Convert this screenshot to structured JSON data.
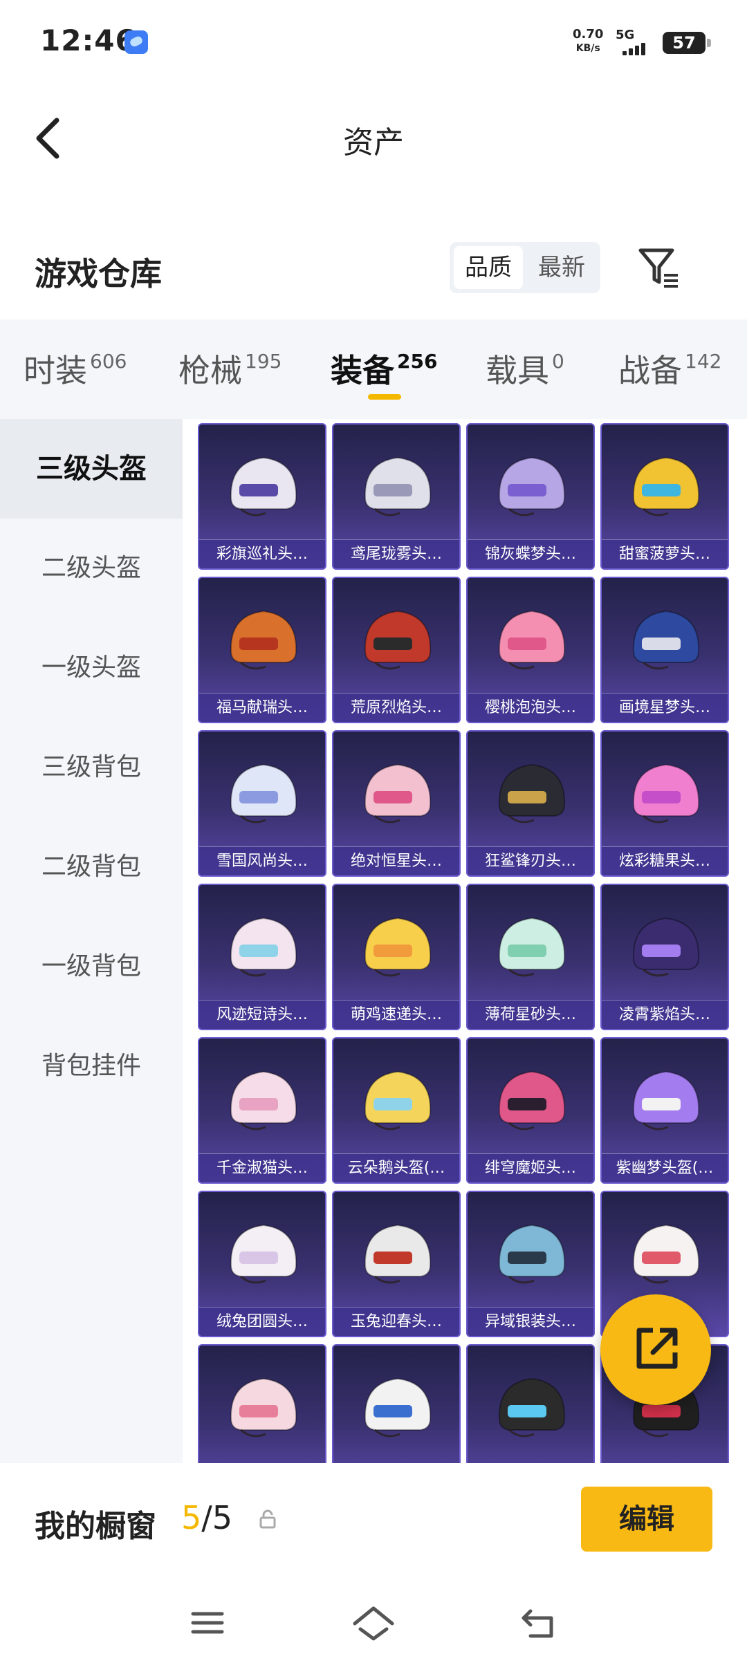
{
  "status_bar": {
    "time": "12:46",
    "speed_value": "0.70",
    "speed_unit": "KB/s",
    "network": "5G",
    "battery": "57"
  },
  "header": {
    "title": "资产"
  },
  "section": {
    "title": "游戏仓库",
    "sort_options": [
      "品质",
      "最新"
    ],
    "active_sort": "品质"
  },
  "categories": [
    {
      "label": "时装",
      "count": "606"
    },
    {
      "label": "枪械",
      "count": "195"
    },
    {
      "label": "装备",
      "count": "256"
    },
    {
      "label": "载具",
      "count": "0"
    },
    {
      "label": "战备",
      "count": "142"
    }
  ],
  "active_category": "装备",
  "subcategories": [
    "三级头盔",
    "二级头盔",
    "一级头盔",
    "三级背包",
    "二级背包",
    "一级背包",
    "背包挂件"
  ],
  "active_subcategory": "三级头盔",
  "items": [
    {
      "label": "彩旗巡礼头…",
      "color": "#e9e6f2",
      "accent": "#5a4aa8"
    },
    {
      "label": "鸢尾珑雾头…",
      "color": "#dfe0ea",
      "accent": "#9a9ab8"
    },
    {
      "label": "锦灰蝶梦头…",
      "color": "#b7a6e6",
      "accent": "#7a5fd0"
    },
    {
      "label": "甜蜜菠萝头…",
      "color": "#f1c232",
      "accent": "#3fb6e0"
    },
    {
      "label": "福马献瑞头…",
      "color": "#d9702c",
      "accent": "#b5351f"
    },
    {
      "label": "荒原烈焰头…",
      "color": "#c0392b",
      "accent": "#2b2b2b"
    },
    {
      "label": "樱桃泡泡头…",
      "color": "#f48fb1",
      "accent": "#e0578a"
    },
    {
      "label": "画境星梦头…",
      "color": "#2e4aa0",
      "accent": "#d9dbe8"
    },
    {
      "label": "雪国风尚头…",
      "color": "#dfe6f8",
      "accent": "#8c9be0"
    },
    {
      "label": "绝对恒星头…",
      "color": "#f3c0cf",
      "accent": "#e0578a"
    },
    {
      "label": "狂鲨锋刃头…",
      "color": "#2b2b33",
      "accent": "#c9a24a"
    },
    {
      "label": "炫彩糖果头…",
      "color": "#f07fd0",
      "accent": "#c44fc9"
    },
    {
      "label": "风迹短诗头…",
      "color": "#f3e4ef",
      "accent": "#8fd3e8"
    },
    {
      "label": "萌鸡速递头…",
      "color": "#f7cf4a",
      "accent": "#f29b3d"
    },
    {
      "label": "薄荷星砂头…",
      "color": "#cdeee2",
      "accent": "#7fcfb0"
    },
    {
      "label": "凌霄紫焰头…",
      "color": "#3a2c6e",
      "accent": "#a37df0"
    },
    {
      "label": "千金淑猫头…",
      "color": "#f6dbe8",
      "accent": "#e8a2c2"
    },
    {
      "label": "云朵鹅头盔(…",
      "color": "#f4d45a",
      "accent": "#8fd3e8"
    },
    {
      "label": "绯穹魔姬头…",
      "color": "#e0578a",
      "accent": "#2b1f2f"
    },
    {
      "label": "紫幽梦头盔(…",
      "color": "#a37df0",
      "accent": "#f2f2f2"
    },
    {
      "label": "绒兔团圆头…",
      "color": "#f4eff4",
      "accent": "#d9c6e6"
    },
    {
      "label": "玉兔迎春头…",
      "color": "#e9e9e9",
      "accent": "#c0392b"
    },
    {
      "label": "异域银装头…",
      "color": "#7fb7d6",
      "accent": "#2b3a4a"
    },
    {
      "label": "",
      "color": "#f6f2f2",
      "accent": "#e05a6a"
    },
    {
      "label": "",
      "color": "#f6d8e0",
      "accent": "#e87f9a"
    },
    {
      "label": "",
      "color": "#f2f2f2",
      "accent": "#3a6fd0"
    },
    {
      "label": "",
      "color": "#2b2b2b",
      "accent": "#5ac8f0"
    },
    {
      "label": "",
      "color": "#1f1f1f",
      "accent": "#d0304a"
    }
  ],
  "bottom_bar": {
    "title": "我的橱窗",
    "count_current": "5",
    "count_sep": "/",
    "count_total": "5",
    "edit_label": "编辑"
  }
}
